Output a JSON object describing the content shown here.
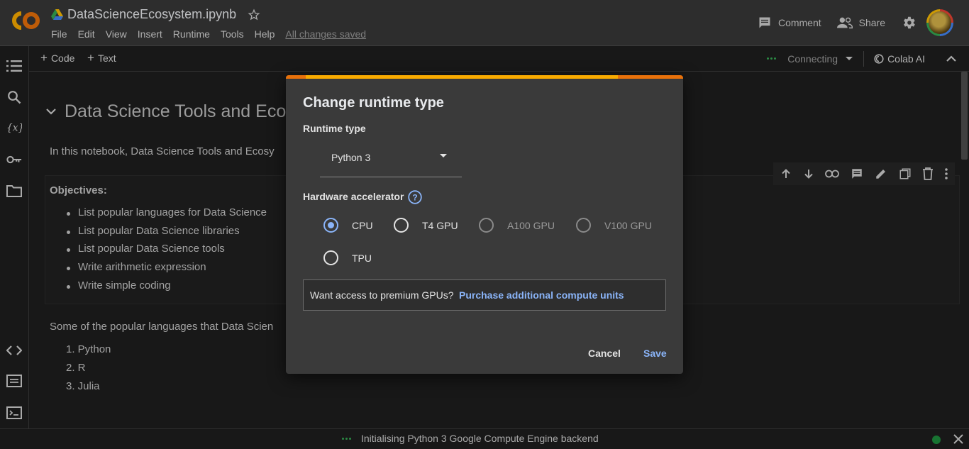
{
  "header": {
    "notebook_title": "DataScienceEcosystem.ipynb",
    "menu": [
      "File",
      "Edit",
      "View",
      "Insert",
      "Runtime",
      "Tools",
      "Help"
    ],
    "save_status": "All changes saved",
    "comment_label": "Comment",
    "share_label": "Share",
    "logo_icon": "colab-logo-icon"
  },
  "toolbar": {
    "add_code_label": "Code",
    "add_text_label": "Text",
    "connection_status": "Connecting",
    "colab_ai_label": "Colab AI"
  },
  "notebook": {
    "heading": "Data Science Tools and Eco",
    "intro": "In this notebook, Data Science Tools and Ecosy",
    "objectives_title": "Objectives:",
    "objectives": [
      "List popular languages for Data Science",
      "List popular Data Science libraries",
      "List popular Data Science tools",
      "Write arithmetic expression",
      "Write simple coding"
    ],
    "languages_intro": "Some of the popular languages that Data Scien",
    "languages": [
      "1. Python",
      "2. R",
      "3. Julia"
    ]
  },
  "status_bar": {
    "message": "Initialising Python 3 Google Compute Engine backend"
  },
  "dialog": {
    "title": "Change runtime type",
    "runtime_type_label": "Runtime type",
    "runtime_type_value": "Python 3",
    "hardware_label": "Hardware accelerator",
    "help_icon_text": "?",
    "options": [
      {
        "label": "CPU",
        "selected": true,
        "disabled": false
      },
      {
        "label": "T4 GPU",
        "selected": false,
        "disabled": false
      },
      {
        "label": "A100 GPU",
        "selected": false,
        "disabled": true
      },
      {
        "label": "V100 GPU",
        "selected": false,
        "disabled": true
      },
      {
        "label": "TPU",
        "selected": false,
        "disabled": false
      }
    ],
    "premium_question": "Want access to premium GPUs?",
    "premium_link": "Purchase additional compute units",
    "cancel_label": "Cancel",
    "save_label": "Save"
  },
  "colors": {
    "accent_blue": "#8ab4f8",
    "progress_orange": "#e8710a",
    "progress_yellow": "#f9ab00",
    "status_green": "#1e8e3e"
  }
}
